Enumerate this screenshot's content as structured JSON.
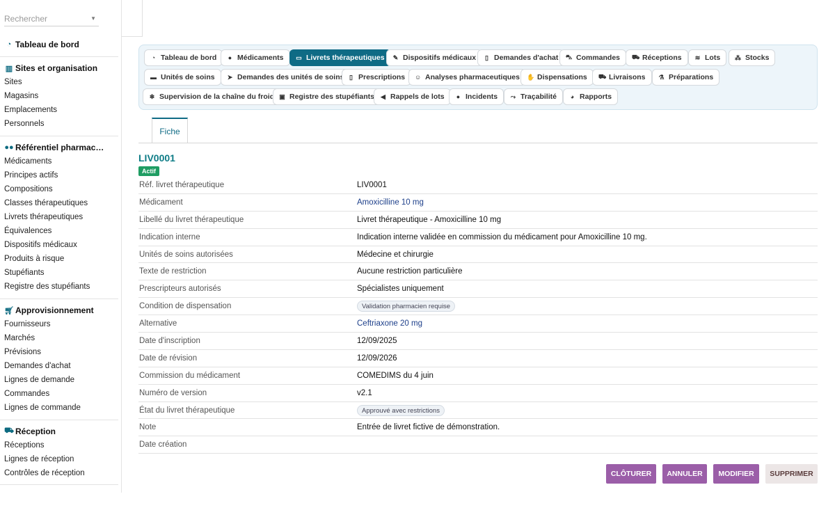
{
  "search": {
    "placeholder": "Rechercher"
  },
  "sidebar": {
    "dashboard": "Tableau de bord",
    "sections": [
      {
        "title": "Sites et organisation",
        "icon": "building-icon",
        "items": [
          "Sites",
          "Magasins",
          "Emplacements",
          "Personnels"
        ]
      },
      {
        "title": "Référentiel pharmac…",
        "icon": "pills-icon",
        "items": [
          "Médicaments",
          "Principes actifs",
          "Compositions",
          "Classes thérapeutiques",
          "Livrets thérapeutiques",
          "Équivalences",
          "Dispositifs médicaux",
          "Produits à risque",
          "Stupéfiants",
          "Registre des stupéfiants"
        ]
      },
      {
        "title": "Approvisionnement",
        "icon": "cart-icon",
        "items": [
          "Fournisseurs",
          "Marchés",
          "Prévisions",
          "Demandes d'achat",
          "Lignes de demande",
          "Commandes",
          "Lignes de commande"
        ]
      },
      {
        "title": "Réception",
        "icon": "truck-icon",
        "items": [
          "Réceptions",
          "Lignes de réception",
          "Contrôles de réception"
        ]
      }
    ]
  },
  "tabs": [
    [
      "Tableau de bord",
      "Médicaments",
      "Livrets thérapeutiques",
      "Dispositifs médicaux",
      "Demandes d'achat",
      "Commandes",
      "Réceptions",
      "Lots",
      "Stocks"
    ],
    [
      "Unités de soins",
      "Demandes des unités de soins",
      "Prescriptions",
      "Analyses pharmaceutiques",
      "Dispensations",
      "Livraisons",
      "Préparations"
    ],
    [
      "Supervision de la chaîne du froid",
      "Registre des stupéfiants",
      "Rappels de lots",
      "Incidents",
      "Traçabilité",
      "Rapports"
    ]
  ],
  "active_tab": "Livrets thérapeutiques",
  "view_tab": "Fiche",
  "record": {
    "id": "LIV0001",
    "status": "Actif",
    "fields": [
      {
        "label": "Réf. livret thérapeutique",
        "value": "LIV0001"
      },
      {
        "label": "Médicament",
        "value": "Amoxicilline 10 mg"
      },
      {
        "label": "Libellé du livret thérapeutique",
        "value": "Livret thérapeutique - Amoxicilline 10 mg"
      },
      {
        "label": "Indication interne",
        "value": "Indication interne validée en commission du médicament pour Amoxicilline 10 mg."
      },
      {
        "label": "Unités de soins autorisées",
        "value": "Médecine et chirurgie"
      },
      {
        "label": "Texte de restriction",
        "value": "Aucune restriction particulière"
      },
      {
        "label": "Prescripteurs autorisés",
        "value": "Spécialistes uniquement"
      },
      {
        "label": "Condition de dispensation",
        "value": "Validation pharmacien requise"
      },
      {
        "label": "Alternative",
        "value": "Ceftriaxone 20 mg"
      },
      {
        "label": "Date d'inscription",
        "value": "12/09/2025"
      },
      {
        "label": "Date de révision",
        "value": "12/09/2026"
      },
      {
        "label": "Commission du médicament",
        "value": "COMEDIMS du 4 juin"
      },
      {
        "label": "Numéro de version",
        "value": "v2.1"
      },
      {
        "label": "État du livret thérapeutique",
        "value": "Approuvé avec restrictions"
      },
      {
        "label": "Note",
        "value": "Entrée de livret fictive de démonstration."
      },
      {
        "label": "Date création",
        "value": ""
      }
    ]
  },
  "actions": {
    "close": "CLÔTURER",
    "cancel": "ANNULER",
    "edit": "MODIFIER",
    "delete": "SUPPRIMER"
  },
  "colors": {
    "accent": "#0f6b85",
    "link": "#1d3f8a",
    "badge": "#1f9d63",
    "action": "#9b5ea8"
  }
}
